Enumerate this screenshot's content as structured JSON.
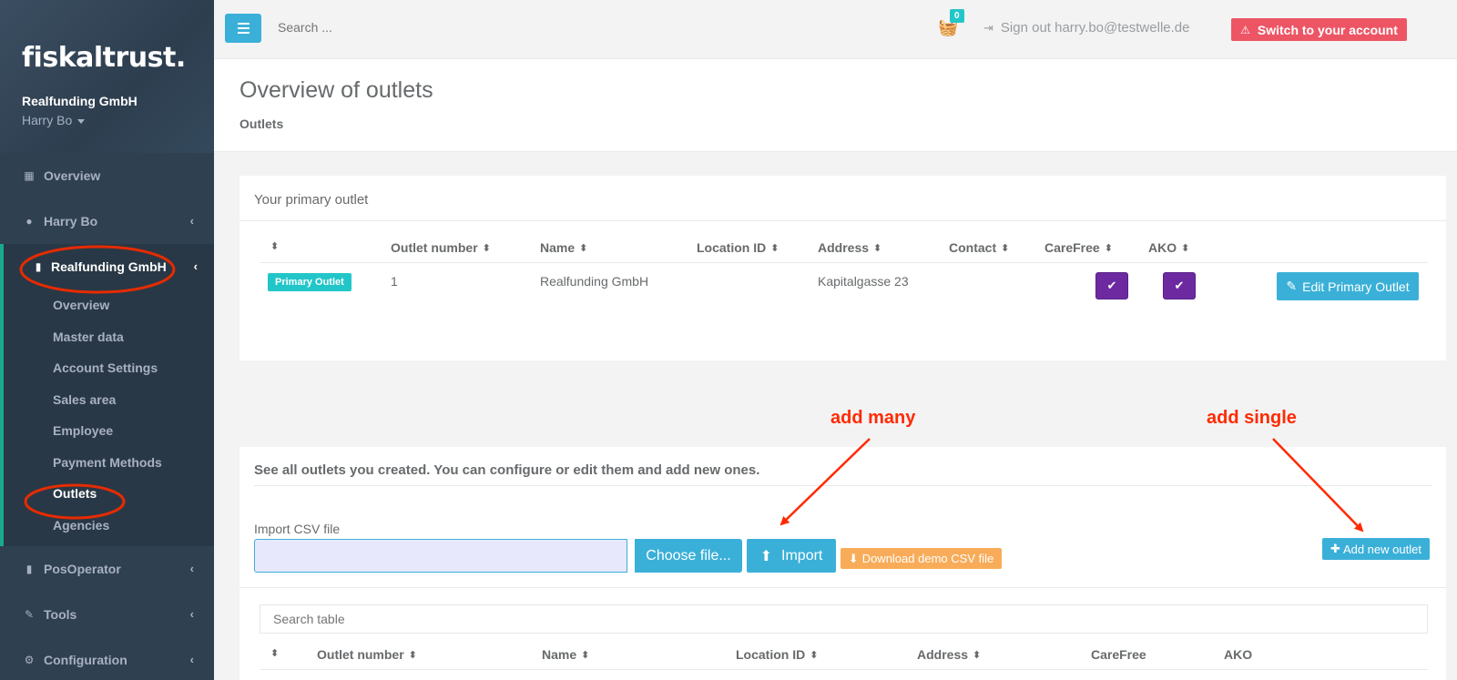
{
  "sidebar": {
    "logo": "fiskaltrust.",
    "company": "Realfunding GmbH",
    "user": "Harry Bo",
    "items": [
      {
        "label": "Overview",
        "icon": "grid-icon"
      },
      {
        "label": "Harry Bo",
        "icon": "user-icon"
      },
      {
        "label": "Realfunding GmbH",
        "icon": "building-icon"
      },
      {
        "label": "PosOperator",
        "icon": "building-icon"
      },
      {
        "label": "Tools",
        "icon": "wrench-icon"
      },
      {
        "label": "Configuration",
        "icon": "cogs-icon"
      }
    ],
    "sub_items": [
      {
        "label": "Overview"
      },
      {
        "label": "Master data"
      },
      {
        "label": "Account Settings"
      },
      {
        "label": "Sales area"
      },
      {
        "label": "Employee"
      },
      {
        "label": "Payment Methods"
      },
      {
        "label": "Outlets"
      },
      {
        "label": "Agencies"
      }
    ]
  },
  "topbar": {
    "search_placeholder": "Search ...",
    "cart_count": "0",
    "signout_label": "Sign out harry.bo@testwelle.de",
    "switch_label": "Switch to your account"
  },
  "heading": {
    "title": "Overview of outlets",
    "breadcrumb": "Outlets"
  },
  "primary_panel": {
    "title": "Your primary outlet",
    "columns": [
      "Outlet number",
      "Name",
      "Location ID",
      "Address",
      "Contact",
      "CareFree",
      "AKO"
    ],
    "row": {
      "badge": "Primary Outlet",
      "number": "1",
      "name": "Realfunding GmbH",
      "location_id": "",
      "address": "Kapitalgasse 23",
      "contact": "",
      "carefree": true,
      "ako": true
    },
    "edit_label": "Edit Primary Outlet"
  },
  "outlets_panel": {
    "description": "See all outlets you created. You can configure or edit them and add new ones.",
    "import_label": "Import CSV file",
    "choose_label": "Choose file...",
    "import_button": "Import",
    "demo_button": "Download demo CSV file",
    "add_button": "Add new outlet",
    "table_search_placeholder": "Search table",
    "columns": [
      "Outlet number",
      "Name",
      "Location ID",
      "Address",
      "CareFree",
      "AKO"
    ]
  },
  "annotations": {
    "add_many": "add many",
    "add_single": "add single"
  },
  "colors": {
    "sidebar_bg": "#2f4050",
    "accent_blue": "#3ab0d8",
    "teal": "#23c6c8",
    "danger": "#ed5565",
    "warning": "#f8ac59",
    "purple": "#6d2aa0",
    "annotation_red": "#ff2a00"
  }
}
